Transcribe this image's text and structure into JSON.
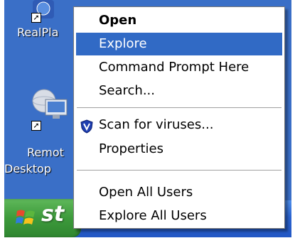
{
  "desktop": {
    "icons": [
      {
        "label": "RealPla"
      },
      {
        "label_line1": "Remot",
        "label_line2": "Desktop"
      }
    ]
  },
  "taskbar": {
    "start_label": "st"
  },
  "menu": {
    "items": [
      {
        "label": "Open"
      },
      {
        "label": "Explore"
      },
      {
        "label": "Command Prompt Here"
      },
      {
        "label": "Search..."
      },
      {
        "label": "Scan for viruses..."
      },
      {
        "label": "Properties"
      },
      {
        "label": "Open All Users"
      },
      {
        "label": "Explore All Users"
      }
    ],
    "selected": "Explore"
  },
  "colors": {
    "desktop": "#3a6fc7",
    "highlight": "#316ac5",
    "start_green": "#3d9a3b"
  },
  "icons": [
    "realplayer-icon",
    "remote-desktop-icon",
    "shortcut-arrow-icon",
    "antivirus-shield-icon",
    "windows-flag-icon"
  ]
}
